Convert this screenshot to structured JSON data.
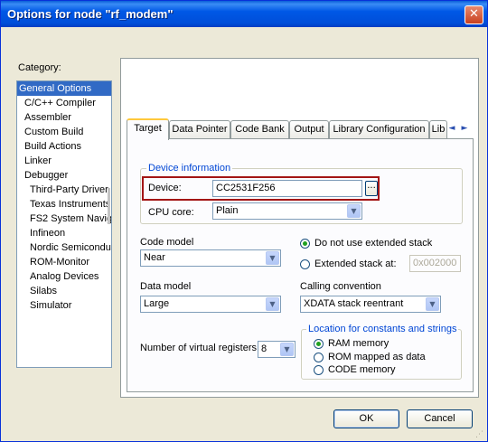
{
  "window": {
    "title": "Options for node \"rf_modem\"",
    "close_glyph": "✕"
  },
  "category": {
    "label": "Category:",
    "items": [
      {
        "label": "General Options",
        "level": 0,
        "selected": true
      },
      {
        "label": "C/C++ Compiler",
        "level": 1
      },
      {
        "label": "Assembler",
        "level": 1
      },
      {
        "label": "Custom Build",
        "level": 1
      },
      {
        "label": "Build Actions",
        "level": 1
      },
      {
        "label": "Linker",
        "level": 1
      },
      {
        "label": "Debugger",
        "level": 1
      },
      {
        "label": "Third-Party Driver",
        "level": 2
      },
      {
        "label": "Texas Instruments",
        "level": 2
      },
      {
        "label": "FS2 System Navig",
        "level": 2
      },
      {
        "label": "Infineon",
        "level": 2
      },
      {
        "label": "Nordic Semiconduc",
        "level": 2
      },
      {
        "label": "ROM-Monitor",
        "level": 2
      },
      {
        "label": "Analog Devices",
        "level": 2
      },
      {
        "label": "Silabs",
        "level": 2
      },
      {
        "label": "Simulator",
        "level": 2
      }
    ]
  },
  "tabs": [
    "Target",
    "Data Pointer",
    "Code Bank",
    "Output",
    "Library Configuration",
    "Lib"
  ],
  "tab_nav": {
    "left": "◄",
    "right": "►"
  },
  "device_info": {
    "group_label": "Device information",
    "device_label": "Device:",
    "device_value": "CC2531F256",
    "browse_label": "...",
    "cpu_label": "CPU core:",
    "cpu_value": "Plain"
  },
  "code_model": {
    "label": "Code model",
    "value": "Near"
  },
  "data_model": {
    "label": "Data model",
    "value": "Large"
  },
  "stack": {
    "option_none": "Do not use extended stack",
    "option_ext": "Extended stack at:",
    "ext_address": "0x002000",
    "selected": "none"
  },
  "calling": {
    "label": "Calling convention",
    "value": "XDATA stack reentrant"
  },
  "virtual_regs": {
    "label": "Number of virtual registers:",
    "value": "8"
  },
  "location": {
    "group_label": "Location for constants and strings",
    "options": [
      "RAM memory",
      "ROM mapped as data",
      "CODE memory"
    ],
    "selected": 0
  },
  "buttons": {
    "ok": "OK",
    "cancel": "Cancel"
  },
  "combo_arrow": "▼"
}
